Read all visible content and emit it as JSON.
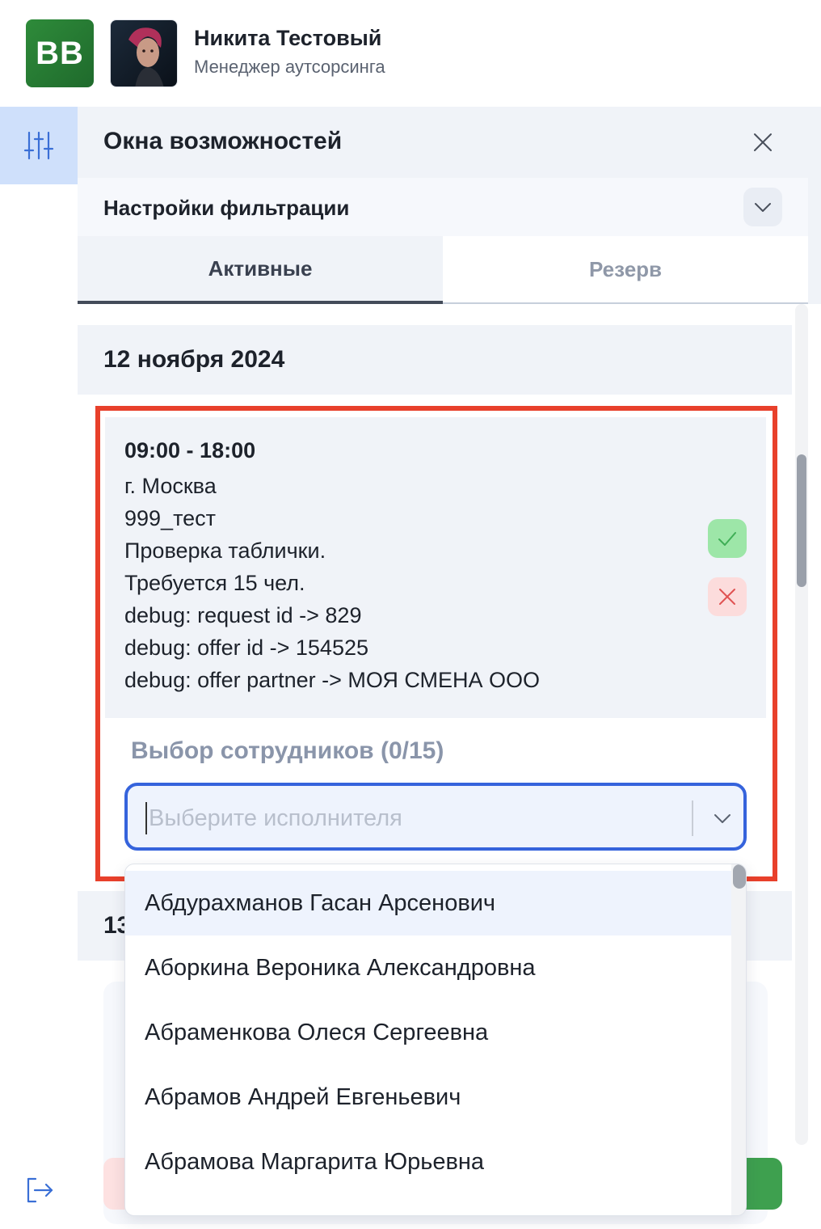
{
  "header": {
    "logo_text": "BB",
    "user_name": "Никита Тестовый",
    "user_role": "Менеджер аутсорсинга"
  },
  "panel": {
    "title": "Окна возможностей",
    "filter_label": "Настройки фильтрации",
    "tabs": [
      {
        "label": "Активные",
        "active": true
      },
      {
        "label": "Резерв",
        "active": false
      }
    ]
  },
  "groups": [
    {
      "date": "12 ноября 2024"
    },
    {
      "date": "13"
    }
  ],
  "offer": {
    "time": "09:00 - 18:00",
    "lines": [
      "г. Москва",
      "999_тест",
      "Проверка таблички.",
      "Требуется 15 чел.",
      "debug: request id -> 829",
      "debug: offer id -> 154525",
      "debug: offer partner -> МОЯ СМЕНА ООО"
    ]
  },
  "employee_select": {
    "title": "Выбор сотрудников (0/15)",
    "placeholder": "Выберите исполнителя",
    "value": ""
  },
  "dropdown": {
    "options": [
      "Абдурахманов Гасан Арсенович",
      "Аборкина Вероника Александровна",
      "Абраменкова Олеся Сергеевна",
      "Абрамов Андрей Евгеньевич",
      "Абрамова Маргарита Юрьевна"
    ],
    "highlighted_index": 0
  },
  "colors": {
    "accent": "#3563dc",
    "highlight_border": "#e8402b",
    "accept": "#9de6a8",
    "reject": "#fcdcdc",
    "brand_green": "#2e8b3a"
  },
  "icons": {
    "rail_filter": "sliders-icon",
    "rail_logout": "logout-icon",
    "close": "close-icon",
    "filter_toggle": "chevron-down-icon",
    "accept": "check-icon",
    "reject": "x-icon",
    "select_chevron": "chevron-down-icon"
  }
}
